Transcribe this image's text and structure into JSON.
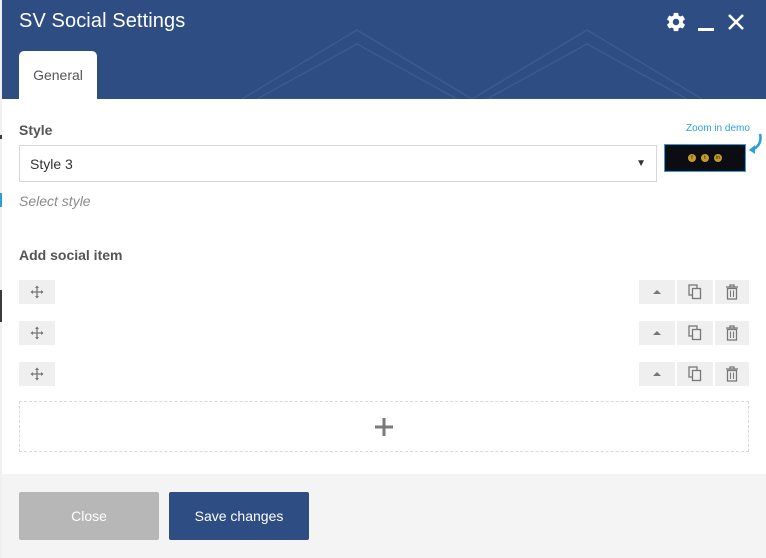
{
  "dialog": {
    "title": "SV Social Settings",
    "icons": {
      "settings": "gear-icon",
      "minimize": "minimize-icon",
      "close": "close-icon"
    }
  },
  "tabs": [
    {
      "label": "General",
      "active": true
    }
  ],
  "style_field": {
    "label": "Style",
    "value": "Style 3",
    "hint": "Select style",
    "zoom_link": "Zoom in demo",
    "demo_icons": [
      "f",
      "t",
      "in"
    ]
  },
  "social_items": {
    "label": "Add social item",
    "rows": [
      {
        "drag_icon": "move-icon",
        "actions": [
          "chevron-up-icon",
          "copy-icon",
          "trash-icon"
        ]
      },
      {
        "drag_icon": "move-icon",
        "actions": [
          "chevron-up-icon",
          "copy-icon",
          "trash-icon"
        ]
      },
      {
        "drag_icon": "move-icon",
        "actions": [
          "chevron-up-icon",
          "copy-icon",
          "trash-icon"
        ]
      }
    ],
    "add_icon": "plus-icon"
  },
  "footer": {
    "close_label": "Close",
    "save_label": "Save changes"
  },
  "colors": {
    "header": "#2e4d83",
    "primary_button": "#2e4d83",
    "secondary_button": "#b7b7b7",
    "link": "#2b9fd8"
  }
}
